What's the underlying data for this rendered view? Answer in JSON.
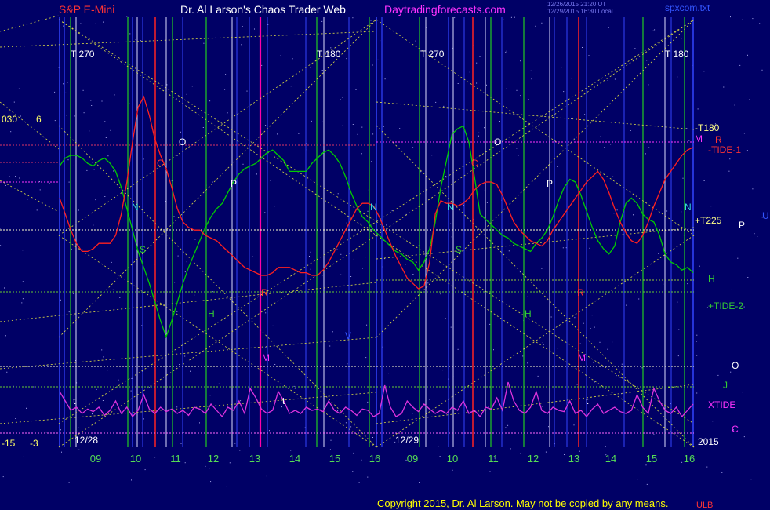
{
  "header": {
    "instrument": "S&P E-Mini",
    "title": "Dr. Al Larson's Chaos Trader Web",
    "site": "Daytradingforecasts.com",
    "stamp_line1": "12/26/2015 21:20 UT",
    "stamp_line2": "12/29/2015 16:30 Local",
    "file": "spxcom.txt"
  },
  "footer": {
    "copyright": "Copyright 2015, Dr. Al Larson. May not be copied by any means.",
    "mark": "ULB"
  },
  "left_labels": {
    "top_left_a": "030",
    "top_left_b": "6",
    "bottom_left_a": "-15",
    "bottom_left_b": "-3"
  },
  "right_labels": {
    "t180": "-T180",
    "m": "M",
    "r": "R",
    "tide1": "-TIDE-1",
    "t225": "+T225",
    "p_white": "P",
    "u": "U",
    "h": "H",
    "tide2": "+TIDE-2",
    "o": "O",
    "j": "J",
    "xtide": "XTIDE",
    "c": "C",
    "year": "2015"
  },
  "panel_labels": {
    "t270_left": "T 270",
    "t180_left": "T 180",
    "t270_right": "T 270",
    "t180_right": "T 180",
    "date_left": "12/28",
    "date_right": "12/29"
  },
  "colors": {
    "background": "#000066",
    "price_line": "#00cc00",
    "forecast_line": "#ff2020",
    "xtide_line": "#dd33dd",
    "grid_yellow": "#dddd44",
    "vline_green": "#22cc22",
    "vline_blue": "#3344ff",
    "vline_red": "#ff2222",
    "vline_magenta": "#ff00aa",
    "vline_white": "#ddddff"
  },
  "chart_data": {
    "type": "line",
    "panels": [
      {
        "date": "12/28",
        "hours": [
          "09",
          "10",
          "11",
          "12",
          "13",
          "14",
          "15",
          "16"
        ]
      },
      {
        "date": "12/29",
        "hours": [
          "09",
          "10",
          "11",
          "12",
          "13",
          "14",
          "15",
          "16"
        ]
      }
    ],
    "x_ticks": [
      "09",
      "10",
      "11",
      "12",
      "13",
      "14",
      "15",
      "16",
      "09",
      "10",
      "11",
      "12",
      "13",
      "14",
      "15",
      "16"
    ],
    "marker_letters": {
      "left_panel": [
        "t",
        "O",
        "N",
        "S",
        "P",
        "H",
        "R",
        "M",
        "V",
        "t",
        "C",
        "N"
      ],
      "right_panel": [
        "O",
        "N",
        "S",
        "P",
        "H",
        "R",
        "M",
        "C",
        "t",
        "N"
      ]
    },
    "series": [
      {
        "name": "",
        "values": [
          0.76,
          0.79,
          0.8,
          0.8,
          0.79,
          0.77,
          0.76,
          0.78,
          0.79,
          0.77,
          0.74,
          0.68,
          0.6,
          0.52,
          0.44,
          0.38,
          0.32,
          0.25,
          0.18,
          0.12,
          0.18,
          0.25,
          0.32,
          0.38,
          0.43,
          0.48,
          0.53,
          0.57,
          0.6,
          0.62,
          0.66,
          0.7,
          0.73,
          0.75,
          0.76,
          0.77,
          0.79,
          0.81,
          0.82,
          0.8,
          0.78,
          0.74,
          0.74,
          0.74,
          0.74,
          0.77,
          0.79,
          0.81,
          0.82,
          0.8,
          0.77,
          0.72,
          0.66,
          0.61,
          0.57,
          0.55,
          0.52,
          0.5,
          0.48,
          0.46,
          0.44,
          0.43,
          0.41,
          0.4,
          0.37,
          0.4,
          0.45,
          0.55,
          0.68,
          0.78,
          0.88,
          0.9,
          0.91,
          0.85,
          0.72,
          0.58,
          0.56,
          0.54,
          0.52,
          0.5,
          0.49,
          0.47,
          0.46,
          0.45,
          0.44,
          0.47,
          0.49,
          0.52,
          0.57,
          0.63,
          0.68,
          0.71,
          0.7,
          0.65,
          0.59,
          0.53,
          0.48,
          0.45,
          0.43,
          0.46,
          0.55,
          0.62,
          0.64,
          0.62,
          0.58,
          0.56,
          0.55,
          0.5,
          0.43,
          0.4,
          0.39,
          0.37,
          0.38,
          0.36
        ]
      },
      {
        "name": "",
        "values": [
          0.64,
          0.58,
          0.52,
          0.47,
          0.44,
          0.44,
          0.45,
          0.47,
          0.47,
          0.47,
          0.5,
          0.58,
          0.7,
          0.85,
          0.98,
          1.02,
          0.95,
          0.86,
          0.8,
          0.75,
          0.68,
          0.6,
          0.55,
          0.53,
          0.52,
          0.52,
          0.5,
          0.49,
          0.48,
          0.46,
          0.44,
          0.42,
          0.4,
          0.38,
          0.37,
          0.36,
          0.35,
          0.35,
          0.36,
          0.38,
          0.38,
          0.38,
          0.37,
          0.36,
          0.36,
          0.35,
          0.35,
          0.37,
          0.4,
          0.44,
          0.48,
          0.52,
          0.56,
          0.6,
          0.62,
          0.62,
          0.61,
          0.57,
          0.52,
          0.47,
          0.42,
          0.38,
          0.34,
          0.32,
          0.3,
          0.31,
          0.4,
          0.58,
          0.63,
          0.62,
          0.62,
          0.61,
          0.62,
          0.64,
          0.67,
          0.69,
          0.7,
          0.7,
          0.69,
          0.65,
          0.6,
          0.55,
          0.52,
          0.5,
          0.48,
          0.47,
          0.46,
          0.48,
          0.52,
          0.55,
          0.58,
          0.61,
          0.64,
          0.67,
          0.7,
          0.72,
          0.74,
          0.71,
          0.66,
          0.6,
          0.55,
          0.51,
          0.48,
          0.47,
          0.5,
          0.55,
          0.61,
          0.66,
          0.71,
          0.74,
          0.77,
          0.8,
          0.82,
          0.83
        ]
      },
      {
        "name": "XTIDE",
        "values": [
          0.7,
          0.55,
          0.4,
          0.45,
          0.35,
          0.42,
          0.38,
          0.45,
          0.32,
          0.4,
          0.55,
          0.35,
          0.45,
          0.3,
          0.4,
          0.65,
          0.42,
          0.35,
          0.45,
          0.38,
          0.42,
          0.35,
          0.4,
          0.32,
          0.45,
          0.42,
          0.35,
          0.5,
          0.4,
          0.3,
          0.45,
          0.4,
          0.55,
          0.35,
          0.75,
          0.6,
          0.42,
          0.35,
          0.4,
          0.7,
          0.55,
          0.35,
          0.4,
          0.35,
          0.45,
          0.4,
          0.42,
          0.38,
          0.55,
          0.4,
          0.35,
          0.45,
          0.4,
          0.32,
          0.42,
          0.4,
          0.3,
          0.35,
          0.8,
          0.45,
          0.3,
          0.35,
          0.55,
          0.45,
          0.38,
          0.5,
          0.42,
          0.35,
          0.4,
          0.35,
          0.45,
          0.4,
          0.55,
          0.35,
          0.4,
          0.3,
          0.45,
          0.42,
          0.6,
          0.4,
          0.85,
          0.55,
          0.4,
          0.35,
          0.45,
          0.7,
          0.4,
          0.35,
          0.45,
          0.4,
          0.38,
          0.55,
          0.35,
          0.4,
          0.3,
          0.42,
          0.5,
          0.35,
          0.4,
          0.45,
          0.38,
          0.35,
          0.4,
          0.65,
          0.45,
          0.35,
          0.75,
          0.55,
          0.4,
          0.35,
          0.45,
          0.3,
          0.4,
          0.5
        ]
      }
    ]
  }
}
